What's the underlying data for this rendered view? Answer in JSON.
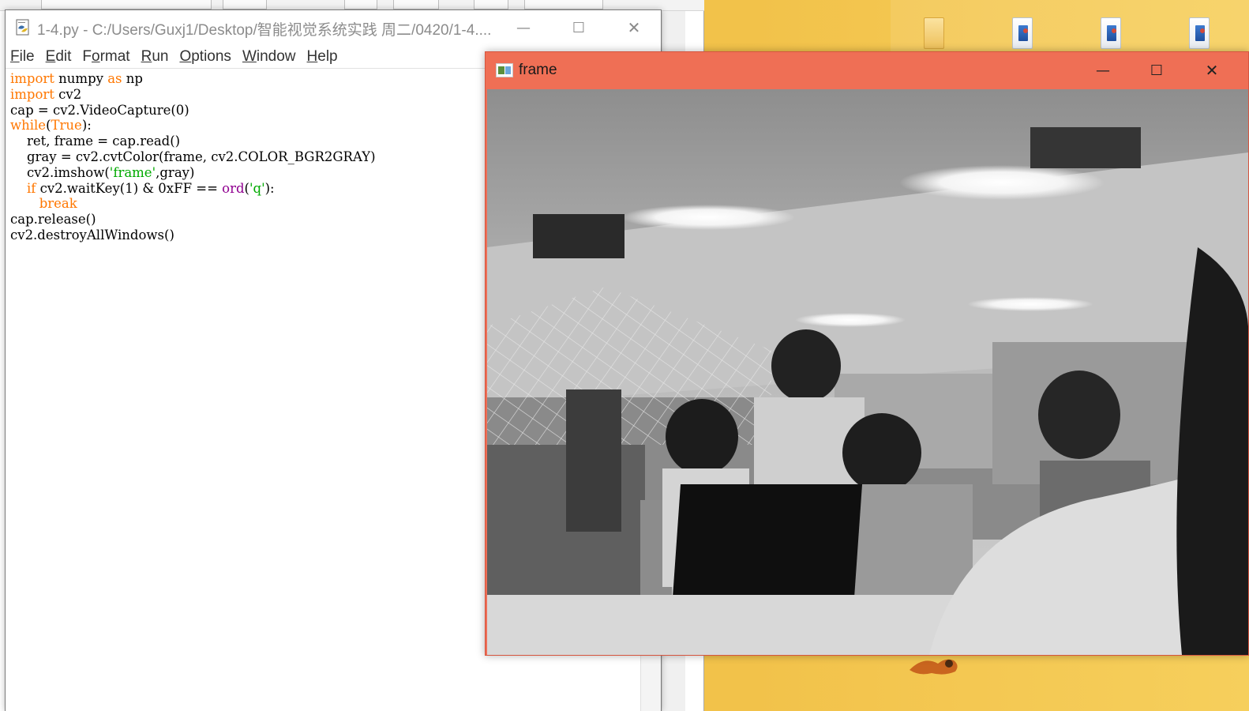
{
  "idle": {
    "title": "1-4.py - C:/Users/Guxj1/Desktop/智能视觉系统实践 周二/0420/1-4....",
    "menu": [
      {
        "label": "File",
        "mnemonic": "F",
        "rest": "ile"
      },
      {
        "label": "Edit",
        "mnemonic": "E",
        "rest": "dit"
      },
      {
        "label": "Format",
        "mnemonic": "o",
        "pre": "F",
        "rest": "rmat"
      },
      {
        "label": "Run",
        "mnemonic": "R",
        "rest": "un"
      },
      {
        "label": "Options",
        "mnemonic": "O",
        "rest": "ptions"
      },
      {
        "label": "Window",
        "mnemonic": "W",
        "rest": "indow"
      },
      {
        "label": "Help",
        "mnemonic": "H",
        "rest": "elp"
      }
    ],
    "code": [
      [
        {
          "t": "import",
          "c": "kw"
        },
        {
          "t": " numpy "
        },
        {
          "t": "as",
          "c": "kw"
        },
        {
          "t": " np"
        }
      ],
      [
        {
          "t": "import",
          "c": "kw"
        },
        {
          "t": " cv2"
        }
      ],
      [
        {
          "t": "cap = cv2.VideoCapture(0)"
        }
      ],
      [
        {
          "t": "while",
          "c": "kw"
        },
        {
          "t": "("
        },
        {
          "t": "True",
          "c": "kw"
        },
        {
          "t": "):"
        }
      ],
      [
        {
          "t": "    ret, frame = cap.read()"
        }
      ],
      [
        {
          "t": "    gray = cv2.cvtColor(frame, cv2.COLOR_BGR2GRAY)"
        }
      ],
      [
        {
          "t": "    cv2.imshow("
        },
        {
          "t": "'frame'",
          "c": "st"
        },
        {
          "t": ",gray)"
        }
      ],
      [
        {
          "t": "    "
        },
        {
          "t": "if",
          "c": "kw"
        },
        {
          "t": " cv2.waitKey(1) & 0xFF == "
        },
        {
          "t": "ord",
          "c": "bi"
        },
        {
          "t": "("
        },
        {
          "t": "'q'",
          "c": "st"
        },
        {
          "t": "):"
        }
      ],
      [
        {
          "t": "       "
        },
        {
          "t": "break",
          "c": "kw"
        }
      ],
      [
        {
          "t": "cap.release()"
        }
      ],
      [
        {
          "t": "cv2.destroyAllWindows()"
        }
      ]
    ],
    "controls": {
      "minimize": "—",
      "maximize": "☐",
      "close": "✕"
    }
  },
  "frame": {
    "title": "frame",
    "controls": {
      "minimize": "—",
      "maximize": "☐",
      "close": "✕"
    },
    "content": "grayscale webcam view"
  },
  "colors": {
    "frame_titlebar": "#ef6f55",
    "desktop": "#f0c64e",
    "keyword": "#ff7700",
    "string": "#00aa00",
    "builtin": "#900090"
  }
}
